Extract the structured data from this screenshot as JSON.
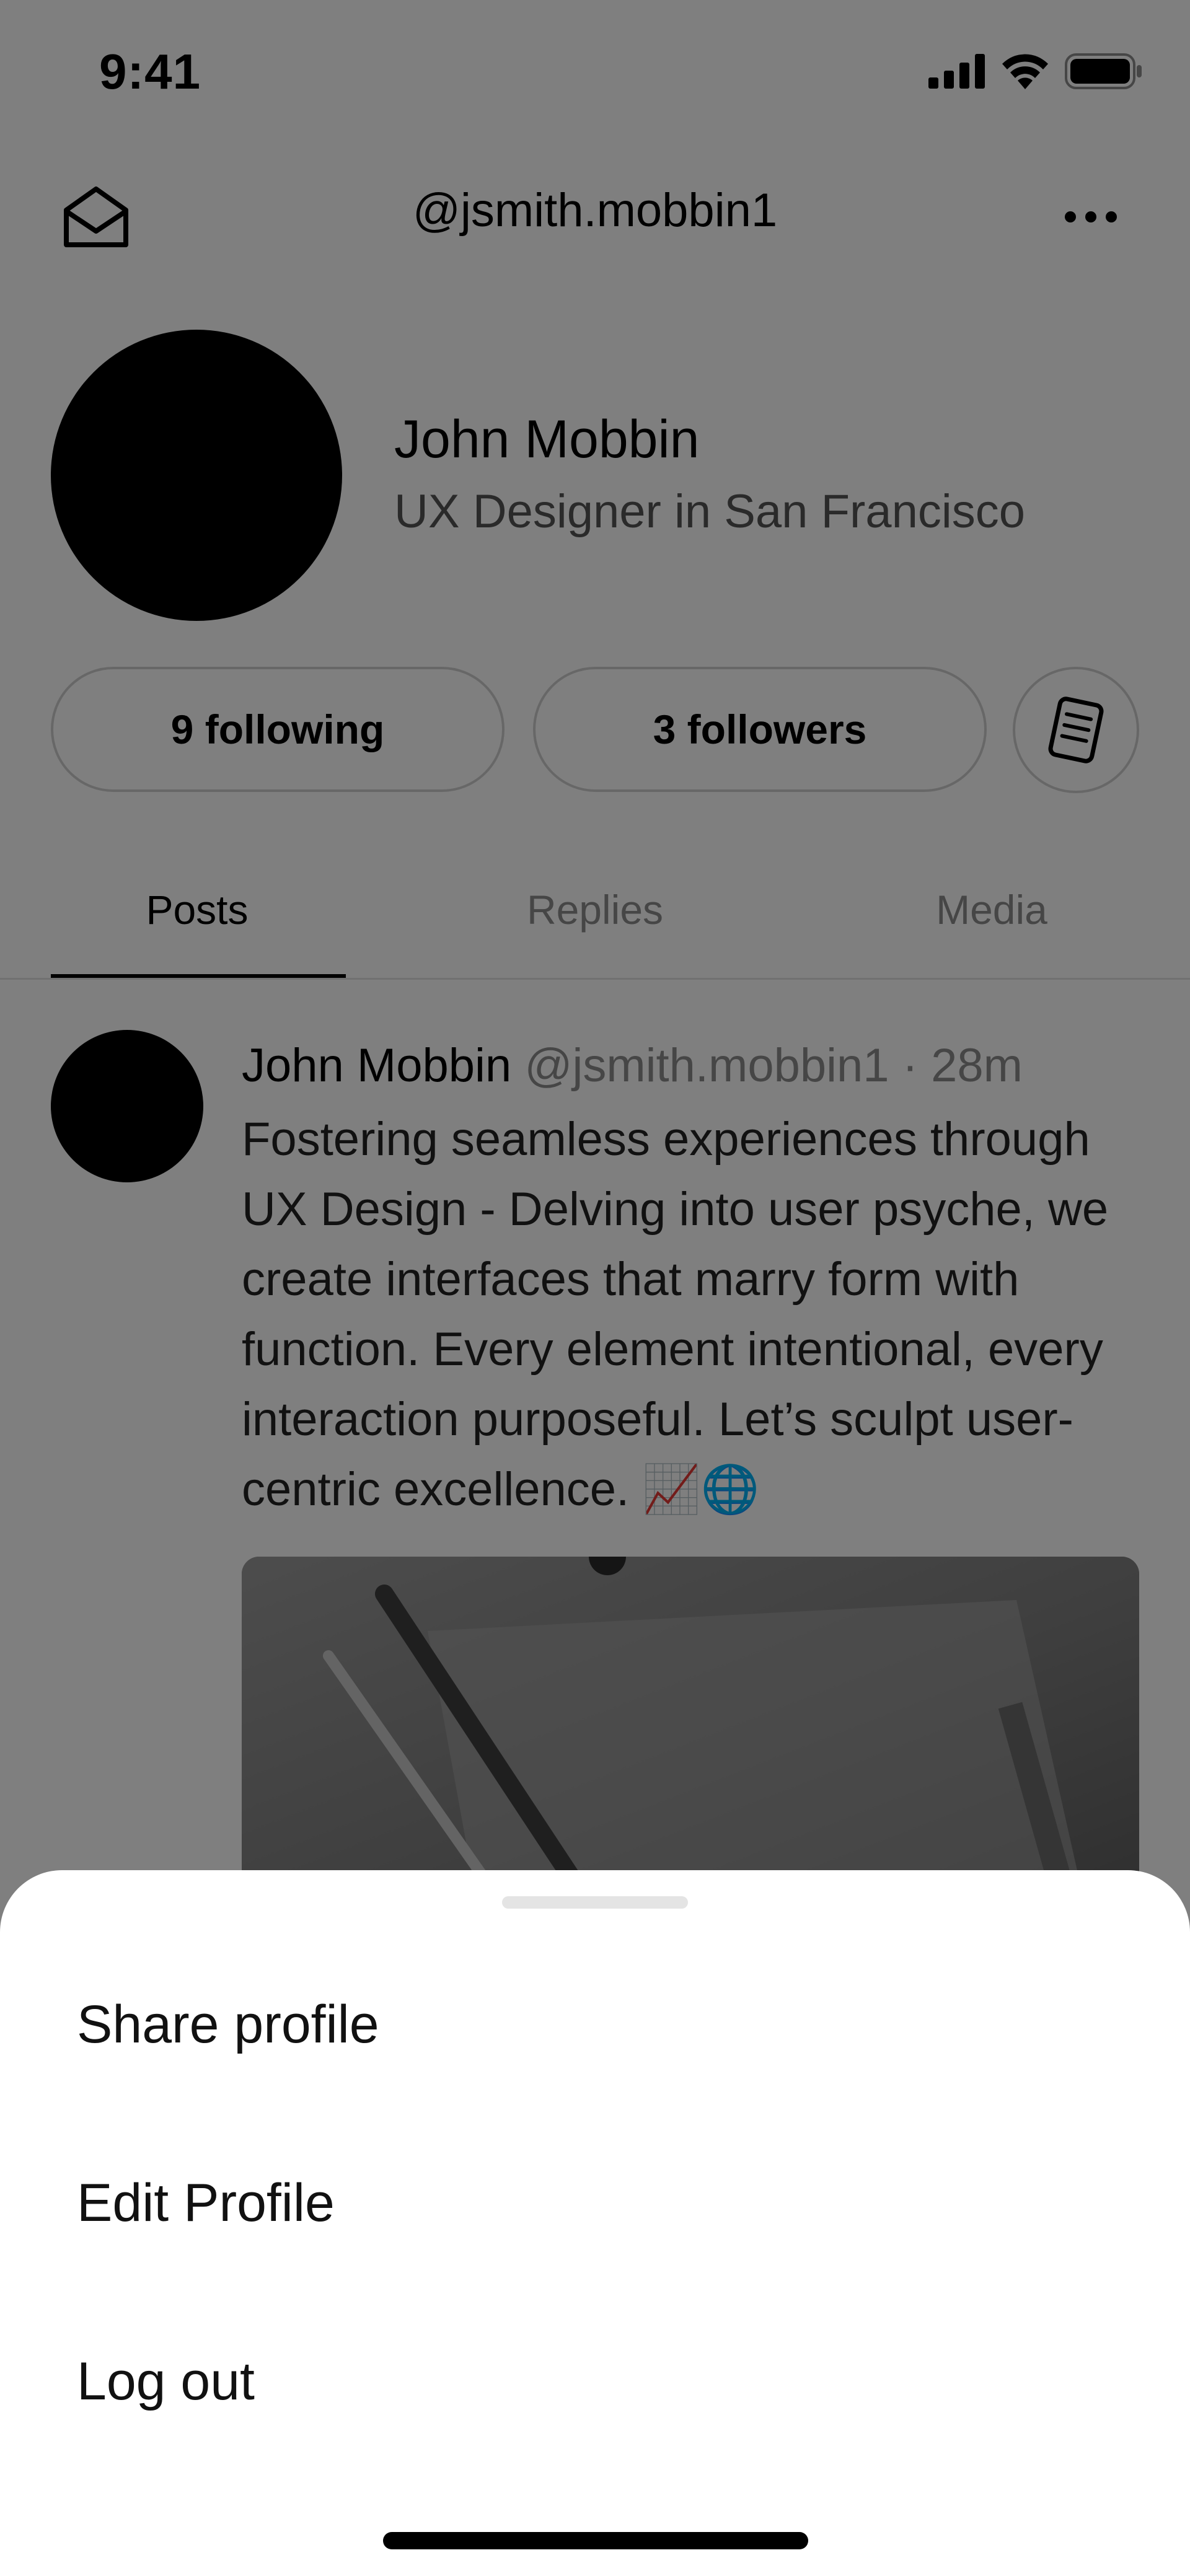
{
  "status_bar": {
    "time": "9:41",
    "icons": [
      "cellular-signal-icon",
      "wifi-icon",
      "battery-icon"
    ]
  },
  "header": {
    "left_icon": "inbox-icon",
    "handle": "@jsmith.mobbin1",
    "right_icon": "more-horizontal-icon"
  },
  "profile": {
    "name": "John Mobbin",
    "bio": "UX Designer in San Francisco",
    "following_label": "9 following",
    "followers_label": "3 followers",
    "notes_icon": "note-icon"
  },
  "tabs": [
    {
      "label": "Posts",
      "active": true
    },
    {
      "label": "Replies",
      "active": false
    },
    {
      "label": "Media",
      "active": false
    }
  ],
  "post": {
    "author": "John Mobbin",
    "handle": "@jsmith.mobbin1",
    "separator": "·",
    "time": "28m",
    "text": "Fostering seamless experiences through UX Design - Delving into user psyche, we create interfaces that marry form with function. Every element intentional, every interaction purposeful. Let’s sculpt user-centric excellence. 📈🌐"
  },
  "sheet": {
    "items": [
      {
        "label": "Share profile"
      },
      {
        "label": "Edit Profile"
      },
      {
        "label": "Log out"
      }
    ]
  },
  "colors": {
    "overlay": "rgba(0,0,0,0.5)",
    "muted_text": "#8c8c8c",
    "pill_border": "#cfcfcf",
    "sheet_bg": "#ffffff"
  }
}
